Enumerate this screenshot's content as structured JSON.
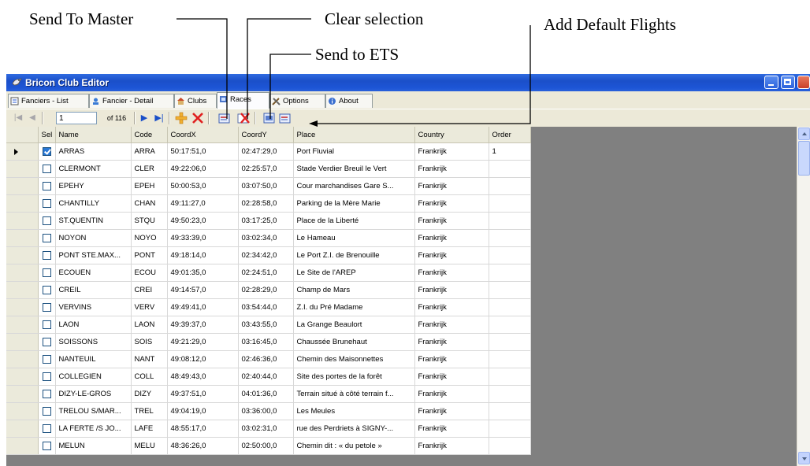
{
  "annotations": {
    "send_to_master": "Send To Master",
    "clear_selection": "Clear selection",
    "send_to_ets": "Send to ETS",
    "add_default_flights": "Add Default Flights"
  },
  "window": {
    "title": "Bricon Club Editor",
    "icon": "pigeon-icon"
  },
  "tabs": [
    {
      "label": "Fanciers - List",
      "icon": "list-icon"
    },
    {
      "label": "Fancier - Detail",
      "icon": "detail-icon"
    },
    {
      "label": "Clubs",
      "icon": "house-icon"
    },
    {
      "label": "Races",
      "icon": "flag-icon",
      "active": true
    },
    {
      "label": "Options",
      "icon": "tools-icon"
    },
    {
      "label": "About",
      "icon": "info-icon"
    }
  ],
  "navigator": {
    "position": "1",
    "count_label": "of 116"
  },
  "grid": {
    "columns": [
      "Sel",
      "Name",
      "Code",
      "CoordX",
      "CoordY",
      "Place",
      "Country",
      "Order"
    ],
    "rows": [
      {
        "sel": true,
        "name": "ARRAS",
        "code": "ARRA",
        "x": "50:17:51,0",
        "y": "02:47:29,0",
        "place": "Port Fluvial",
        "country": "Frankrijk",
        "order": "1",
        "current": true
      },
      {
        "sel": false,
        "name": "CLERMONT",
        "code": "CLER",
        "x": "49:22:06,0",
        "y": "02:25:57,0",
        "place": "Stade Verdier Breuil le Vert",
        "country": "Frankrijk",
        "order": ""
      },
      {
        "sel": false,
        "name": "EPEHY",
        "code": "EPEH",
        "x": "50:00:53,0",
        "y": "03:07:50,0",
        "place": "Cour marchandises Gare S...",
        "country": "Frankrijk",
        "order": ""
      },
      {
        "sel": false,
        "name": "CHANTILLY",
        "code": "CHAN",
        "x": "49:11:27,0",
        "y": "02:28:58,0",
        "place": "Parking de la Mère Marie",
        "country": "Frankrijk",
        "order": ""
      },
      {
        "sel": false,
        "name": "ST.QUENTIN",
        "code": "STQU",
        "x": "49:50:23,0",
        "y": "03:17:25,0",
        "place": "Place de la Liberté",
        "country": "Frankrijk",
        "order": ""
      },
      {
        "sel": false,
        "name": "NOYON",
        "code": "NOYO",
        "x": "49:33:39,0",
        "y": "03:02:34,0",
        "place": "Le Hameau",
        "country": "Frankrijk",
        "order": ""
      },
      {
        "sel": false,
        "name": "PONT STE.MAX...",
        "code": "PONT",
        "x": "49:18:14,0",
        "y": "02:34:42,0",
        "place": "Le Port Z.I. de Brenouille",
        "country": "Frankrijk",
        "order": ""
      },
      {
        "sel": false,
        "name": "ECOUEN",
        "code": "ECOU",
        "x": "49:01:35,0",
        "y": "02:24:51,0",
        "place": "Le Site de l'AREP",
        "country": "Frankrijk",
        "order": ""
      },
      {
        "sel": false,
        "name": "CREIL",
        "code": "CREI",
        "x": "49:14:57,0",
        "y": "02:28:29,0",
        "place": "Champ de Mars",
        "country": "Frankrijk",
        "order": ""
      },
      {
        "sel": false,
        "name": "VERVINS",
        "code": "VERV",
        "x": "49:49:41,0",
        "y": "03:54:44,0",
        "place": "Z.I. du Pré Madame",
        "country": "Frankrijk",
        "order": ""
      },
      {
        "sel": false,
        "name": "LAON",
        "code": "LAON",
        "x": "49:39:37,0",
        "y": "03:43:55,0",
        "place": "La Grange Beaulort",
        "country": "Frankrijk",
        "order": ""
      },
      {
        "sel": false,
        "name": "SOISSONS",
        "code": "SOIS",
        "x": "49:21:29,0",
        "y": "03:16:45,0",
        "place": "Chaussée Brunehaut",
        "country": "Frankrijk",
        "order": ""
      },
      {
        "sel": false,
        "name": "NANTEUIL",
        "code": "NANT",
        "x": "49:08:12,0",
        "y": "02:46:36,0",
        "place": "Chemin des Maisonnettes",
        "country": "Frankrijk",
        "order": ""
      },
      {
        "sel": false,
        "name": "COLLEGIEN",
        "code": "COLL",
        "x": "48:49:43,0",
        "y": "02:40:44,0",
        "place": "Site des portes de la forêt",
        "country": "Frankrijk",
        "order": ""
      },
      {
        "sel": false,
        "name": "DIZY-LE-GROS",
        "code": "DIZY",
        "x": "49:37:51,0",
        "y": "04:01:36,0",
        "place": "Terrain situé à côté terrain f...",
        "country": "Frankrijk",
        "order": ""
      },
      {
        "sel": false,
        "name": "TRELOU S/MAR...",
        "code": "TREL",
        "x": "49:04:19,0",
        "y": "03:36:00,0",
        "place": "Les Meules",
        "country": "Frankrijk",
        "order": ""
      },
      {
        "sel": false,
        "name": "LA FERTE /S JO...",
        "code": "LAFE",
        "x": "48:55:17,0",
        "y": "03:02:31,0",
        "place": "rue des Perdriets à SIGNY-...",
        "country": "Frankrijk",
        "order": ""
      },
      {
        "sel": false,
        "name": "MELUN",
        "code": "MELU",
        "x": "48:36:26,0",
        "y": "02:50:00,0",
        "place": "Chemin dit : « du petole »",
        "country": "Frankrijk",
        "order": ""
      }
    ]
  },
  "colors": {
    "titlebar": "#1b4fc9",
    "grid_background": "#808080",
    "checkbox_checked": "#2a79d6"
  }
}
